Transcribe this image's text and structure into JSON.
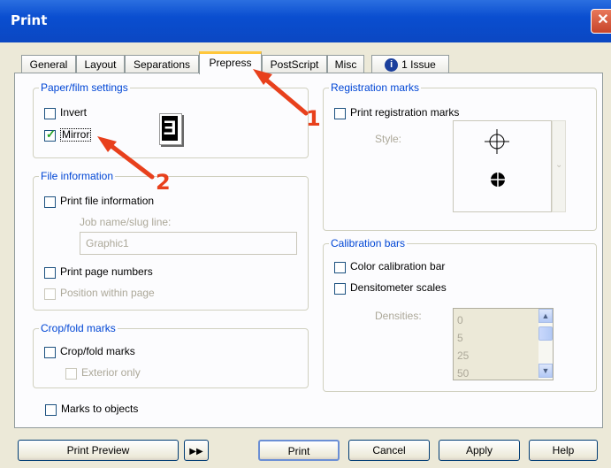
{
  "window": {
    "title": "Print",
    "close_icon": "close-icon"
  },
  "tabs": [
    {
      "label": "General"
    },
    {
      "label": "Layout"
    },
    {
      "label": "Separations"
    },
    {
      "label": "Prepress",
      "active": true
    },
    {
      "label": "PostScript"
    },
    {
      "label": "Misc"
    },
    {
      "label": "1 Issue",
      "icon": "info-icon"
    }
  ],
  "paper_film": {
    "legend": "Paper/film settings",
    "invert_label": "Invert",
    "invert_checked": false,
    "mirror_label": "Mirror",
    "mirror_checked": true,
    "preview_glyph": "E"
  },
  "file_info": {
    "legend": "File information",
    "print_file_info_label": "Print file information",
    "job_name_label": "Job name/slug line:",
    "job_name_value": "Graphic1",
    "print_page_numbers_label": "Print page numbers",
    "position_within_page_label": "Position within page"
  },
  "crop_fold": {
    "legend": "Crop/fold marks",
    "crop_fold_label": "Crop/fold marks",
    "exterior_only_label": "Exterior only"
  },
  "marks_to_objects_label": "Marks to objects",
  "registration": {
    "legend": "Registration marks",
    "print_registration_label": "Print registration marks",
    "style_label": "Style:"
  },
  "calibration": {
    "legend": "Calibration bars",
    "color_calibration_label": "Color calibration bar",
    "densitometer_label": "Densitometer scales",
    "densities_label": "Densities:",
    "densities_values": [
      "0",
      "5",
      "25",
      "50"
    ]
  },
  "buttons": {
    "print_preview": "Print Preview",
    "print": "Print",
    "cancel": "Cancel",
    "apply": "Apply",
    "help": "Help"
  },
  "annotations": {
    "marker_1": "1",
    "marker_2": "2",
    "color": "#e8401c"
  }
}
